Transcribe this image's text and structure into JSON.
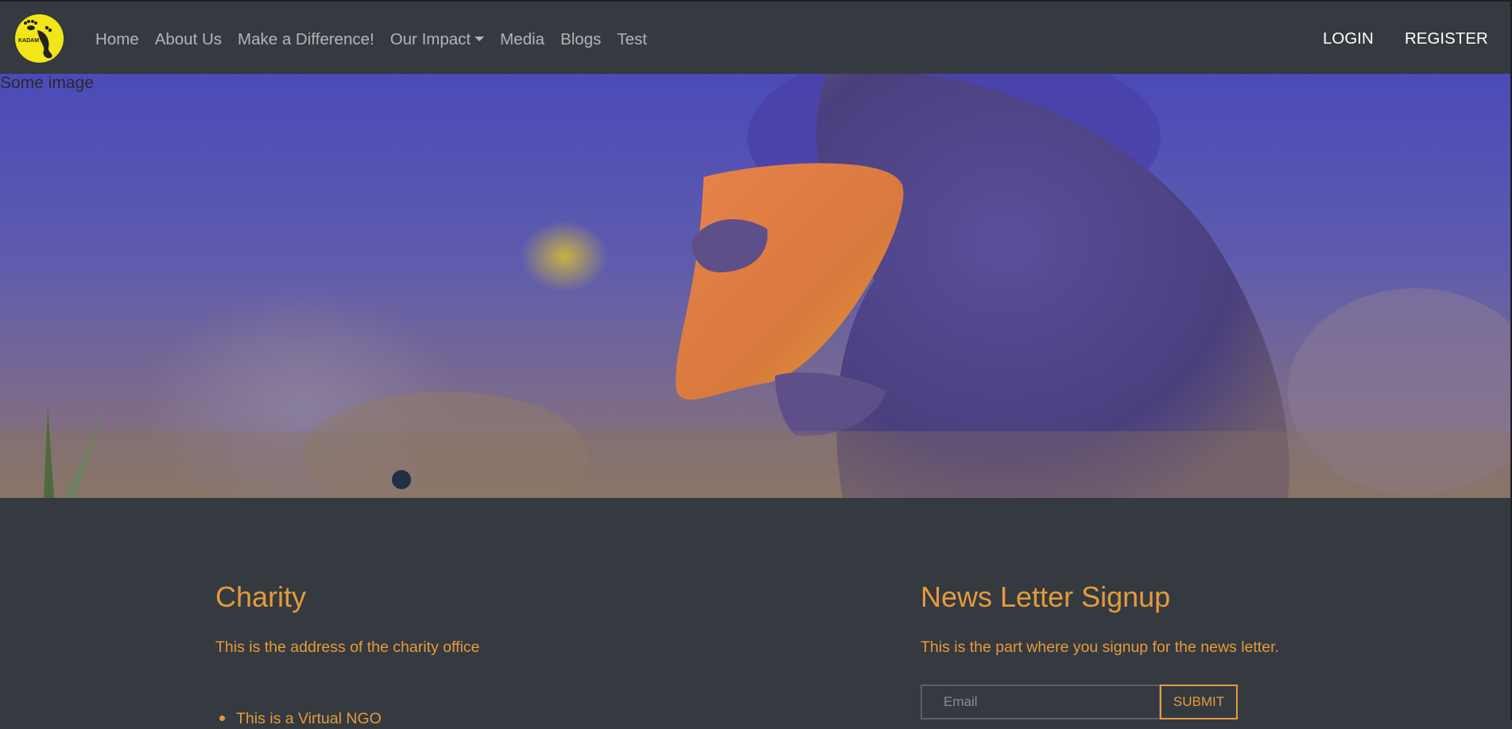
{
  "brand": {
    "logo_text": "KADAM"
  },
  "nav": {
    "items": [
      {
        "label": "Home"
      },
      {
        "label": "About Us"
      },
      {
        "label": "Make a Difference!"
      },
      {
        "label": "Our Impact",
        "dropdown": true
      },
      {
        "label": "Media"
      },
      {
        "label": "Blogs"
      },
      {
        "label": "Test"
      }
    ],
    "login": "LOGIN",
    "register": "REGISTER"
  },
  "hero": {
    "alt_text": "Some image"
  },
  "footer": {
    "charity": {
      "title": "Charity",
      "address": "This is the address of the charity office",
      "list": [
        "This is a Virtual NGO"
      ]
    },
    "newsletter": {
      "title": "News Letter Signup",
      "description": "This is the part where you signup for the news letter.",
      "email_placeholder": "Email",
      "submit_label": "SUBMIT"
    }
  },
  "colors": {
    "navbar_bg": "#343a40",
    "accent": "#e69a3b",
    "logo_yellow": "#f2e51a"
  }
}
